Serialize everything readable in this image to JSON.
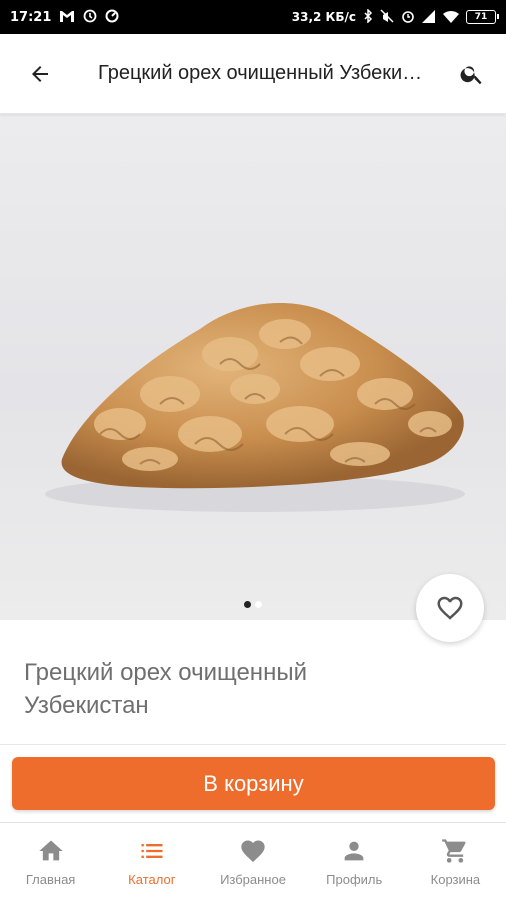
{
  "status_bar": {
    "time": "17:21",
    "left_icons": [
      "gmail-icon",
      "vpn-icon",
      "speedometer-icon"
    ],
    "network_speed": "33,2 КБ/с",
    "right_icons": [
      "bluetooth-icon",
      "mute-icon",
      "alarm-icon",
      "signal-icon",
      "wifi-icon"
    ],
    "battery": "71"
  },
  "app_bar": {
    "title": "Грецкий орех очищенный Узбекистан",
    "back_icon": "arrow-back-icon",
    "search_icon": "search-icon"
  },
  "product": {
    "name": "Грецкий орех очищенный Узбекистан",
    "image_count": 2,
    "active_image": 1
  },
  "actions": {
    "add_to_cart": "В корзину",
    "favorite_icon": "heart-outline-icon"
  },
  "bottom_nav": {
    "items": [
      {
        "label": "Главная",
        "icon": "home-icon",
        "active": false
      },
      {
        "label": "Каталог",
        "icon": "list-icon",
        "active": true
      },
      {
        "label": "Избранное",
        "icon": "heart-icon",
        "active": false
      },
      {
        "label": "Профиль",
        "icon": "person-icon",
        "active": false
      },
      {
        "label": "Корзина",
        "icon": "cart-icon",
        "active": false
      }
    ]
  },
  "colors": {
    "accent": "#ee6d2d",
    "inactive": "#8c8c8c",
    "status_bar": "#000000"
  }
}
